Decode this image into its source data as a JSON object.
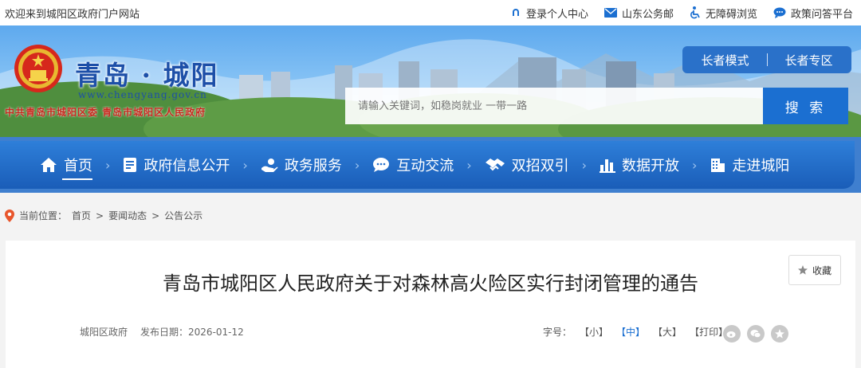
{
  "topbar": {
    "welcome": "欢迎来到城阳区政府门户网站",
    "links": [
      "登录个人中心",
      "山东公务邮",
      "无障碍浏览",
      "政策问答平台"
    ]
  },
  "header": {
    "title": "青岛 · 城阳",
    "url": "www.chengyang.gov.cn",
    "org": "中共青岛市城阳区委 青岛市城阳区人民政府",
    "elder_mode": "长者模式",
    "elder_zone": "长者专区"
  },
  "search": {
    "placeholder": "请输入关键词，如稳岗就业 一带一路",
    "button": "搜 索"
  },
  "nav": {
    "items": [
      "首页",
      "政府信息公开",
      "政务服务",
      "互动交流",
      "双招双引",
      "数据开放",
      "走进城阳"
    ]
  },
  "breadcrumb": {
    "prefix": "当前位置：",
    "items": [
      "首页",
      "要闻动态",
      "公告公示"
    ],
    "sep": ">"
  },
  "article": {
    "collect": "收藏",
    "title": "青岛市城阳区人民政府关于对森林高火险区实行封闭管理的通告",
    "source": "城阳区政府",
    "date_label": "发布日期：",
    "date": "2026-01-12",
    "font_label": "字号：",
    "font_small": "【小】",
    "font_mid": "【中】",
    "font_large": "【大】",
    "print": "【打印】"
  },
  "colors": {
    "primary": "#1b6fd1",
    "nav": "#2e7fd9",
    "org_red": "#c8281e",
    "title_blue": "#1d4fa8"
  }
}
